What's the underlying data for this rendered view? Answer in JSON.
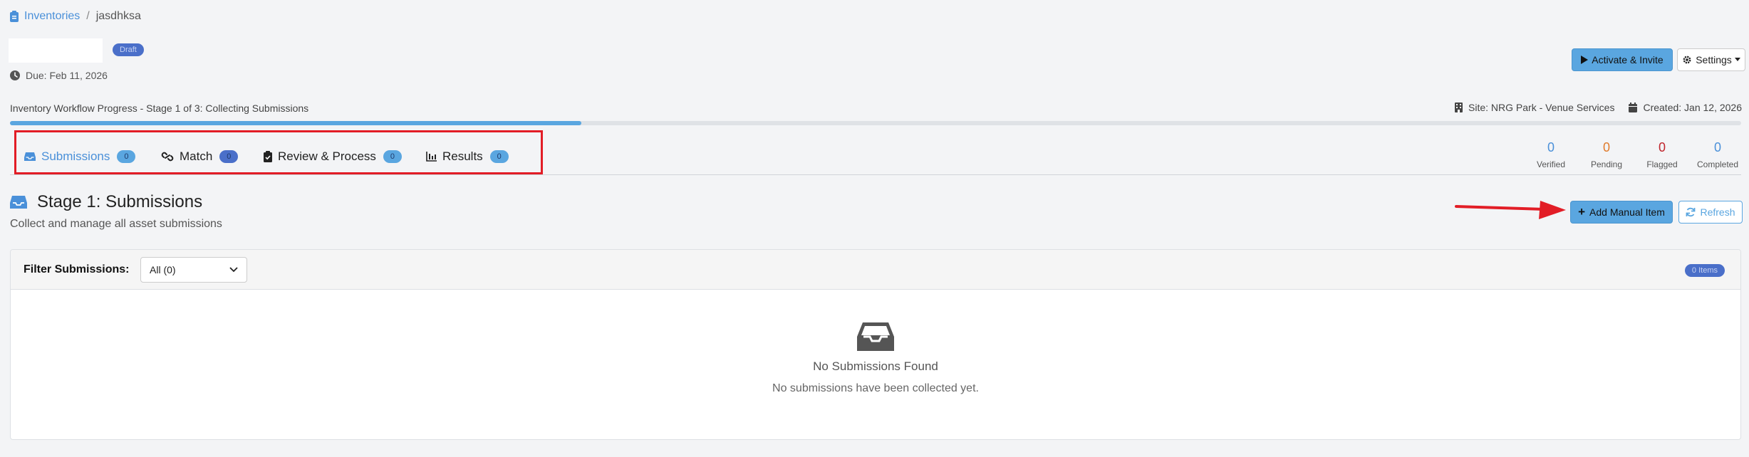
{
  "breadcrumb": {
    "root": "Inventories",
    "separator": "/",
    "current": "jasdhksa"
  },
  "header": {
    "draft_badge": "Draft",
    "due": "Due: Feb 11, 2026",
    "activate_label": "Activate & Invite",
    "settings_label": "Settings"
  },
  "progress": {
    "label": "Inventory Workflow Progress - Stage 1 of 3: Collecting Submissions",
    "site": "Site: NRG Park - Venue Services",
    "created": "Created: Jan 12, 2026",
    "value": 0.33
  },
  "tabs": [
    {
      "label": "Submissions",
      "count": "0"
    },
    {
      "label": "Match",
      "count": "0"
    },
    {
      "label": "Review & Process",
      "count": "0"
    },
    {
      "label": "Results",
      "count": "0"
    }
  ],
  "stats": [
    {
      "value": "0",
      "label": "Verified",
      "color": "#4a90d9"
    },
    {
      "value": "0",
      "label": "Pending",
      "color": "#e07b2c"
    },
    {
      "value": "0",
      "label": "Flagged",
      "color": "#c0262d"
    },
    {
      "value": "0",
      "label": "Completed",
      "color": "#4a90d9"
    }
  ],
  "stage": {
    "title": "Stage 1: Submissions",
    "subtitle": "Collect and manage all asset submissions",
    "add_label": "Add Manual Item",
    "refresh_label": "Refresh"
  },
  "filter": {
    "label": "Filter Submissions:",
    "selected": "All (0)",
    "items_badge": "0 Items"
  },
  "empty": {
    "title": "No Submissions Found",
    "message": "No submissions have been collected yet."
  },
  "colors": {
    "accent": "#5aa6e0",
    "link": "#4a90d9",
    "highlight": "#e21d26",
    "badge_dark": "#4a6fc9"
  }
}
